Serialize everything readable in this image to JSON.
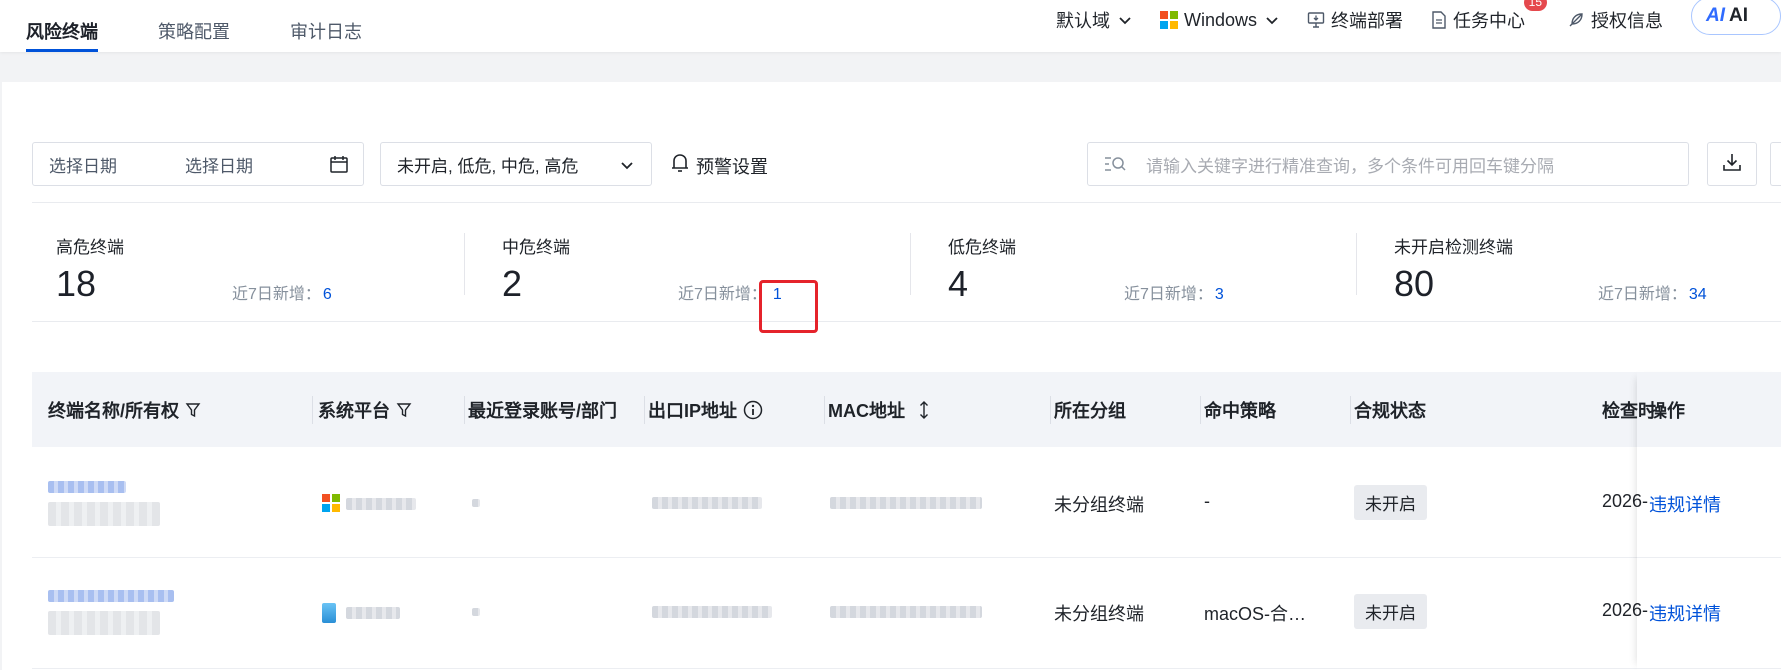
{
  "tabs": [
    {
      "label": "风险终端",
      "active": true
    },
    {
      "label": "策略配置",
      "active": false
    },
    {
      "label": "审计日志",
      "active": false
    }
  ],
  "topnav": {
    "domain": "默认域",
    "os": "Windows",
    "deploy": "终端部署",
    "task_center": "任务中心",
    "task_badge": "15",
    "license": "授权信息",
    "ai_prefix": "AI",
    "ai_label": "AI"
  },
  "filters": {
    "date_start_placeholder": "选择日期",
    "date_end_placeholder": "选择日期",
    "risk_select_value": "未开启, 低危, 中危, 高危",
    "alert_settings": "预警设置",
    "search_placeholder": "请输入关键字进行精准查询，多个条件可用回车键分隔"
  },
  "stats": [
    {
      "label": "高危终端",
      "value": "18",
      "sub_label": "近7日新增：",
      "sub_value": "6"
    },
    {
      "label": "中危终端",
      "value": "2",
      "sub_label": "近7日新增：",
      "sub_value": "1"
    },
    {
      "label": "低危终端",
      "value": "4",
      "sub_label": "近7日新增：",
      "sub_value": "3"
    },
    {
      "label": "未开启检测终端",
      "value": "80",
      "sub_label": "近7日新增：",
      "sub_value": "34"
    }
  ],
  "table": {
    "columns": [
      "终端名称/所有权",
      "系统平台",
      "最近登录账号/部门",
      "出口IP地址",
      "MAC地址",
      "所在分组",
      "命中策略",
      "合规状态",
      "检查时",
      "操作"
    ],
    "rows": [
      {
        "group": "未分组终端",
        "policy": "-",
        "status": "未开启",
        "check_time": "2026-",
        "action": "违规详情",
        "platform_icon": "windows-icon"
      },
      {
        "group": "未分组终端",
        "policy": "macOS-合…",
        "status": "未开启",
        "check_time": "2026-",
        "action": "违规详情",
        "platform_icon": "macos-icon"
      }
    ]
  },
  "colors": {
    "primary": "#0052d9",
    "highlight_box": "#e5232b",
    "badge": "#e5484d"
  }
}
